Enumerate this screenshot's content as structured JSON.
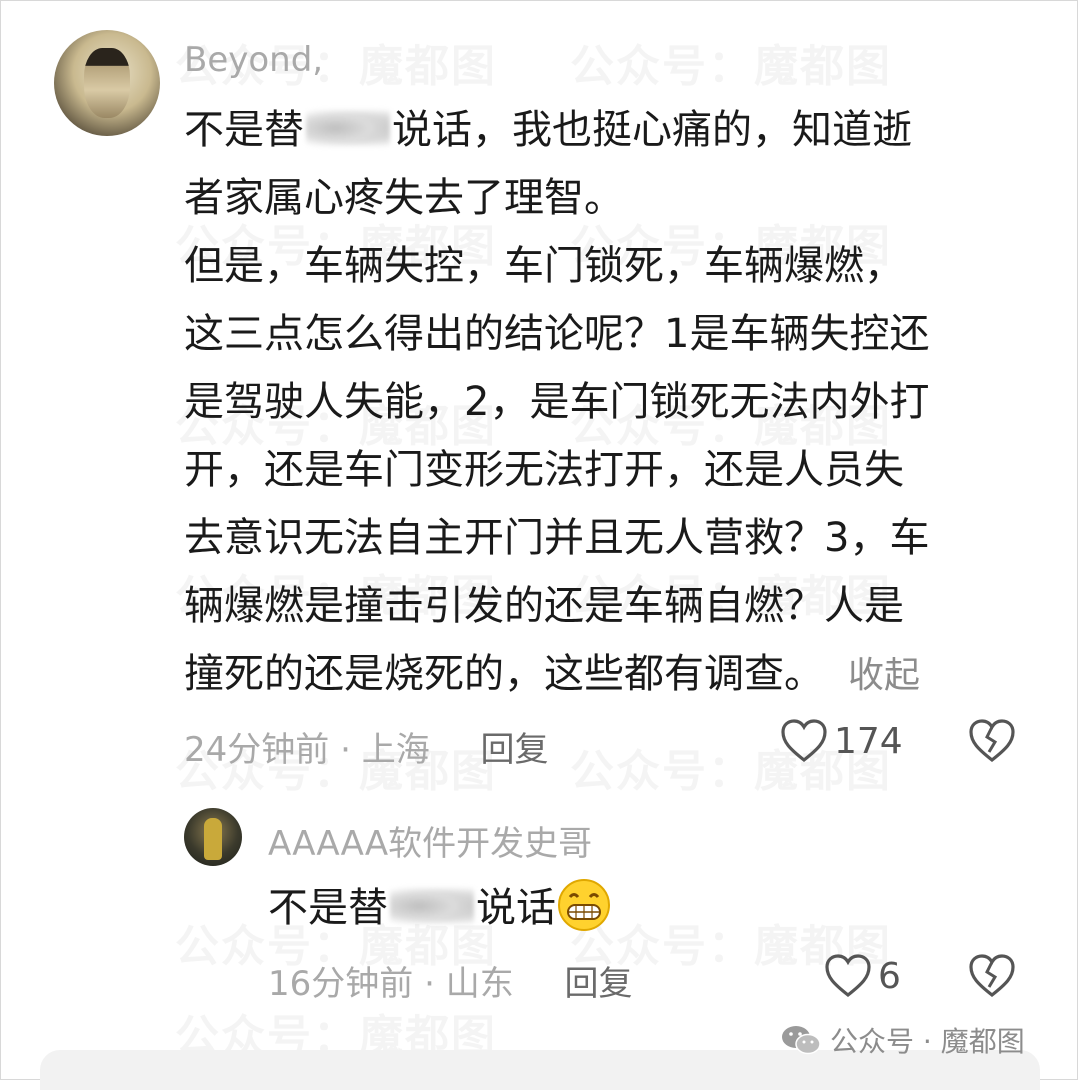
{
  "watermark": "公众号：魔都图",
  "comment": {
    "username": "Beyond,",
    "text_line1_pre": "不是替",
    "text_line1_post": "说话，我也挺心痛的，知道逝",
    "lines": [
      "者家属心疼失去了理智。",
      "但是，车辆失控，车门锁死，车辆爆燃，",
      "这三点怎么得出的结论呢？1是车辆失控还",
      "是驾驶人失能，2，是车门锁死无法内外打",
      "开，还是车门变形无法打开，还是人员失",
      "去意识无法自主开门并且无人营救？3，车",
      "辆爆燃是撞击引发的还是车辆自燃？人是"
    ],
    "last_line": "撞死的还是烧死的，这些都有调查。",
    "collapse_label": "收起",
    "time": "24分钟前",
    "location": "上海",
    "reply_label": "回复",
    "like_count": "174"
  },
  "reply": {
    "username": "AAAAA软件开发史哥",
    "text_pre": "不是替",
    "text_post": "说话",
    "time": "16分钟前",
    "location": "山东",
    "reply_label": "回复",
    "like_count": "6"
  },
  "brand": {
    "label": "公众号 · 魔都图"
  },
  "colors": {
    "meta_gray": "#a9a9a9",
    "text": "#1a1a1a"
  }
}
